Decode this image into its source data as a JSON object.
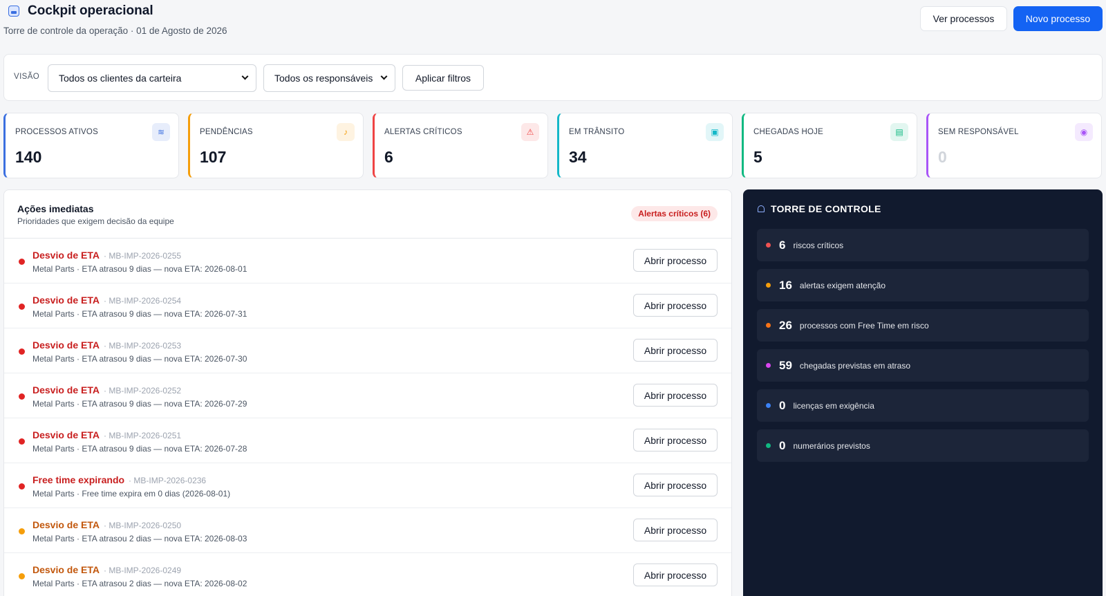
{
  "header": {
    "title": "Cockpit operacional",
    "subtitle": "Torre de controle da operação · 01 de Agosto de 2026",
    "btn_ver": "Ver processos",
    "btn_novo": "Novo processo"
  },
  "filters": {
    "visao_label": "VISÃO",
    "client_select": "Todos os clientes da carteira",
    "owner_select": "Todos os responsáveis",
    "apply_button": "Aplicar filtros"
  },
  "kpis": [
    {
      "label": "PROCESSOS ATIVOS",
      "value": "140",
      "color": "#3b6fe0",
      "icon": "layers-icon"
    },
    {
      "label": "PENDÊNCIAS",
      "value": "107",
      "color": "#f59e0b",
      "icon": "bell-icon"
    },
    {
      "label": "ALERTAS CRÍTICOS",
      "value": "6",
      "color": "#ef4444",
      "icon": "warning-icon"
    },
    {
      "label": "EM TRÂNSITO",
      "value": "34",
      "color": "#14b8c8",
      "icon": "truck-icon"
    },
    {
      "label": "CHEGADAS HOJE",
      "value": "5",
      "color": "#10b981",
      "icon": "calendar-icon"
    },
    {
      "label": "SEM RESPONSÁVEL",
      "value": "0",
      "color": "#a855f7",
      "icon": "user-icon"
    }
  ],
  "actions": {
    "title": "Ações imediatas",
    "subtitle": "Prioridades que exigem decisão da equipe",
    "badge": "Alertas críticos (6)",
    "open_label": "Abrir processo",
    "items": [
      {
        "title": "Desvio de ETA",
        "code": "· MB-IMP-2026-0255",
        "desc": "Metal Parts · ETA atrasou 9 dias — nova ETA: 2026-08-01",
        "severity": "critical"
      },
      {
        "title": "Desvio de ETA",
        "code": "· MB-IMP-2026-0254",
        "desc": "Metal Parts · ETA atrasou 9 dias — nova ETA: 2026-07-31",
        "severity": "critical"
      },
      {
        "title": "Desvio de ETA",
        "code": "· MB-IMP-2026-0253",
        "desc": "Metal Parts · ETA atrasou 9 dias — nova ETA: 2026-07-30",
        "severity": "critical"
      },
      {
        "title": "Desvio de ETA",
        "code": "· MB-IMP-2026-0252",
        "desc": "Metal Parts · ETA atrasou 9 dias — nova ETA: 2026-07-29",
        "severity": "critical"
      },
      {
        "title": "Desvio de ETA",
        "code": "· MB-IMP-2026-0251",
        "desc": "Metal Parts · ETA atrasou 9 dias — nova ETA: 2026-07-28",
        "severity": "critical"
      },
      {
        "title": "Free time expirando",
        "code": "· MB-IMP-2026-0236",
        "desc": "Metal Parts · Free time expira em 0 dias (2026-08-01)",
        "severity": "critical"
      },
      {
        "title": "Desvio de ETA",
        "code": "· MB-IMP-2026-0250",
        "desc": "Metal Parts · ETA atrasou 2 dias — nova ETA: 2026-08-03",
        "severity": "warning"
      },
      {
        "title": "Desvio de ETA",
        "code": "· MB-IMP-2026-0249",
        "desc": "Metal Parts · ETA atrasou 2 dias — nova ETA: 2026-08-02",
        "severity": "warning"
      }
    ]
  },
  "torre": {
    "title": "TORRE DE CONTROLE",
    "items": [
      {
        "value": "6",
        "label": "riscos críticos",
        "color": "#f05252"
      },
      {
        "value": "16",
        "label": "alertas exigem atenção",
        "color": "#f59e0b"
      },
      {
        "value": "26",
        "label": "processos com Free Time em risco",
        "color": "#f97316"
      },
      {
        "value": "59",
        "label": "chegadas previstas em atraso",
        "color": "#d946ef"
      },
      {
        "value": "0",
        "label": "licenças em exigência",
        "color": "#3b82f6"
      },
      {
        "value": "0",
        "label": "numerários previstos",
        "color": "#10b981"
      }
    ]
  },
  "colors": {
    "critical": "#c81e1e",
    "critical_dot": "#e02424",
    "warning": "#c2570c",
    "warning_dot": "#f59e0b"
  }
}
